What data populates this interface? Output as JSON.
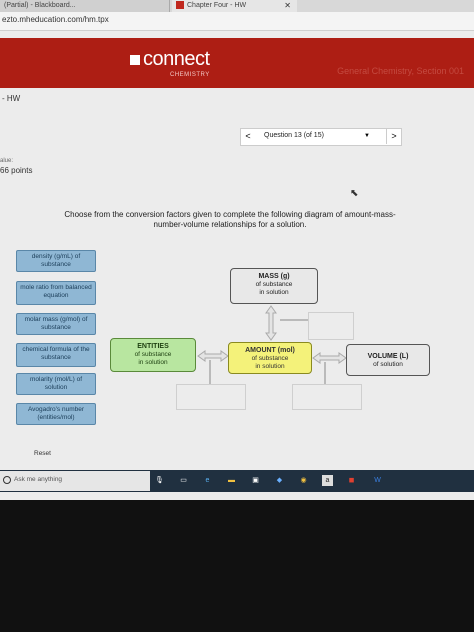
{
  "browser": {
    "tab1_title": "(Partial) - Blackboard...",
    "tab2_title": "Chapter Four - HW",
    "url": "ezto.mheducation.com/hm.tpx"
  },
  "header": {
    "logo": "connect",
    "logo_sub": "CHEMISTRY",
    "course": "General Chemistry, Section 001",
    "brand_color": "#ad1e14"
  },
  "assignment": {
    "title": "- HW",
    "value_label": "alue:",
    "points": "66 points"
  },
  "question_nav": {
    "prev": "<",
    "label": "Question 13 (of 15)",
    "dropdown": "▼",
    "next": ">"
  },
  "instructions": "Choose from the conversion factors given to complete the following diagram of amount-mass-number-volume relationships for a solution.",
  "factors": [
    {
      "label": "density (g/mL) of substance"
    },
    {
      "label": "mole ratio from balanced equation"
    },
    {
      "label": "molar mass (g/mol) of substance"
    },
    {
      "label": "chemical formula of the substance"
    },
    {
      "label": "molarity (mol/L) of solution"
    },
    {
      "label": "Avogadro's number (entities/mol)"
    }
  ],
  "nodes": {
    "mass": {
      "title": "MASS (g)",
      "line1": "of substance",
      "line2": "in solution"
    },
    "entities": {
      "title": "ENTITIES",
      "line1": "of substance",
      "line2": "in solution"
    },
    "amount": {
      "title": "AMOUNT (mol)",
      "line1": "of substance",
      "line2": "in solution"
    },
    "volume": {
      "title": "VOLUME (L)",
      "line1": "of solution"
    }
  },
  "reset": "Reset",
  "taskbar": {
    "search_placeholder": "Ask me anything"
  }
}
